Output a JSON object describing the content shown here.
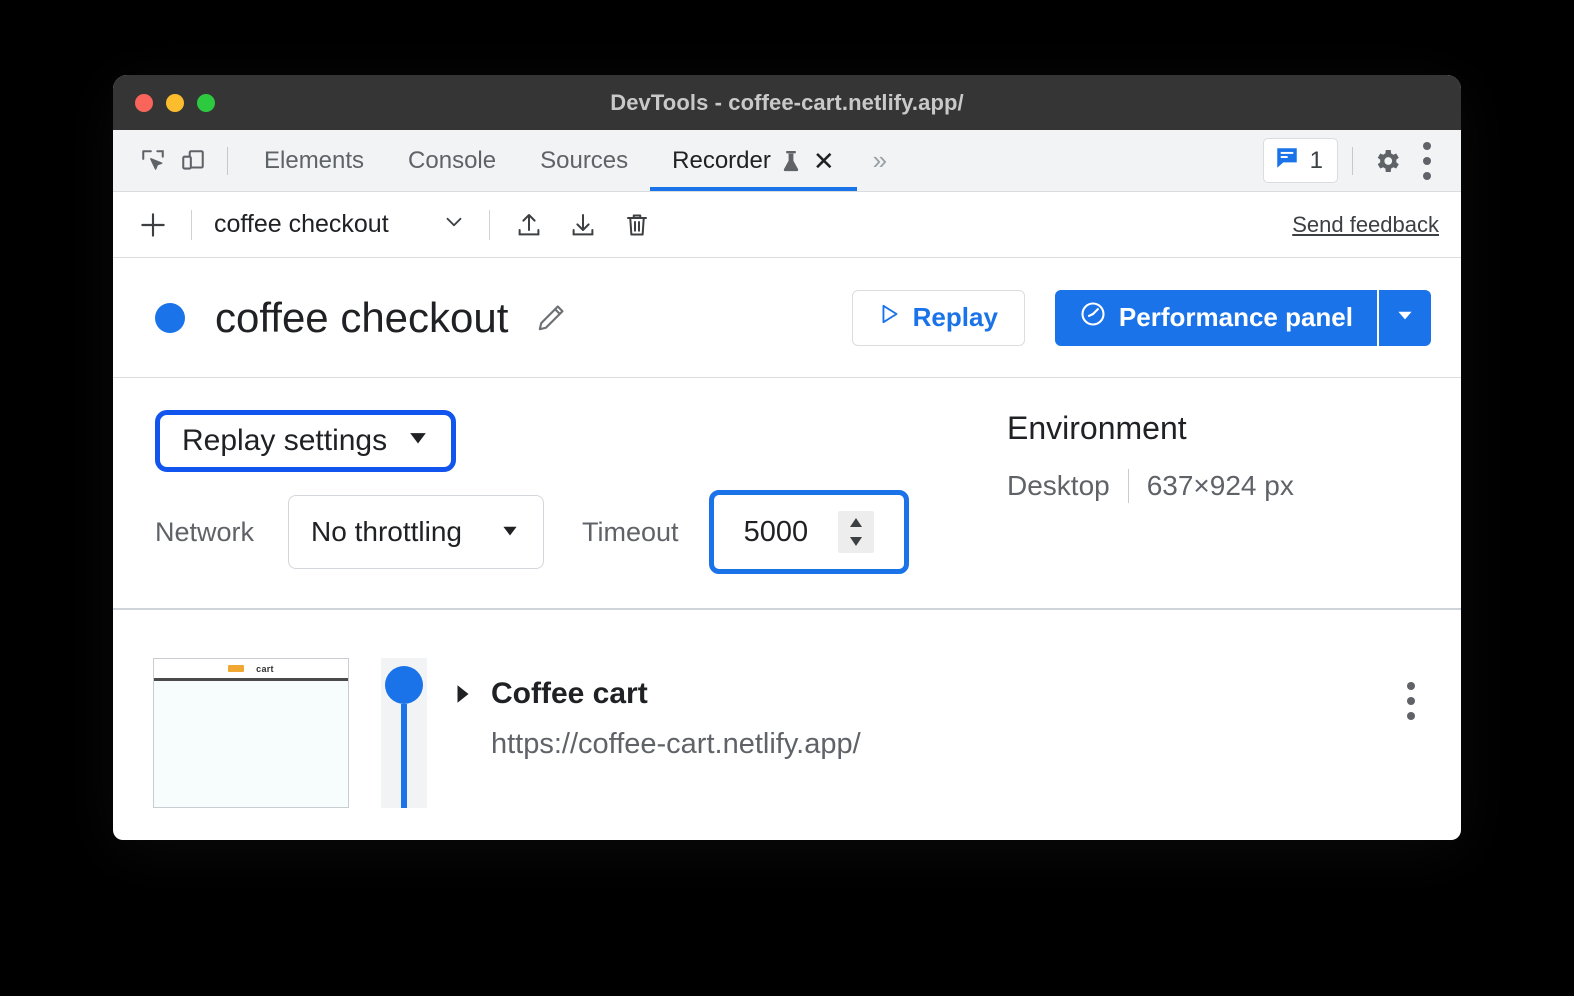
{
  "window": {
    "title": "DevTools - coffee-cart.netlify.app/",
    "traffic_lights": [
      "close",
      "minimize",
      "zoom"
    ]
  },
  "tabbar": {
    "inspect_icon": "inspect-cursor-icon",
    "device_icon": "device-toolbar-icon",
    "tabs": [
      {
        "label": "Elements",
        "active": false
      },
      {
        "label": "Console",
        "active": false
      },
      {
        "label": "Sources",
        "active": false
      },
      {
        "label": "Recorder",
        "active": true,
        "experimental": true,
        "closable": true
      }
    ],
    "more_tabs": "»",
    "issues_count": "1",
    "issues_icon": "issues-message-icon",
    "settings_icon": "gear-icon",
    "overflow_icon": "kebab-menu-icon"
  },
  "toolbar": {
    "add_label": "+",
    "recording_name": "coffee checkout",
    "chevron": "chevron-down-icon",
    "export_icon": "export-upload-icon",
    "import_icon": "import-download-icon",
    "delete_icon": "trash-icon",
    "send_feedback": "Send feedback"
  },
  "header": {
    "status_dot_color": "#1a73e8",
    "title": "coffee checkout",
    "edit_icon": "pencil-edit-icon",
    "replay_label": "Replay",
    "replay_icon": "play-triangle-icon",
    "performance_label": "Performance panel",
    "performance_icon": "performance-gauge-icon",
    "performance_caret": "chevron-down-icon",
    "accent_color": "#1a73e8"
  },
  "settings": {
    "replay_settings_label": "Replay settings",
    "replay_settings_caret": "triangle-down-icon",
    "highlight_color": "#1155ee",
    "network_label": "Network",
    "network_value": "No throttling",
    "network_caret": "triangle-down-icon",
    "timeout_label": "Timeout",
    "timeout_value": "5000",
    "timeout_highlight_color": "#1a73e8",
    "environment_title": "Environment",
    "environment_device": "Desktop",
    "environment_size": "637×924 px"
  },
  "steps": [
    {
      "title": "Coffee cart",
      "url": "https://coffee-cart.netlify.app/",
      "thumbnail_word": "cart",
      "caret": "triangle-right-icon",
      "menu_icon": "kebab-menu-icon"
    }
  ]
}
